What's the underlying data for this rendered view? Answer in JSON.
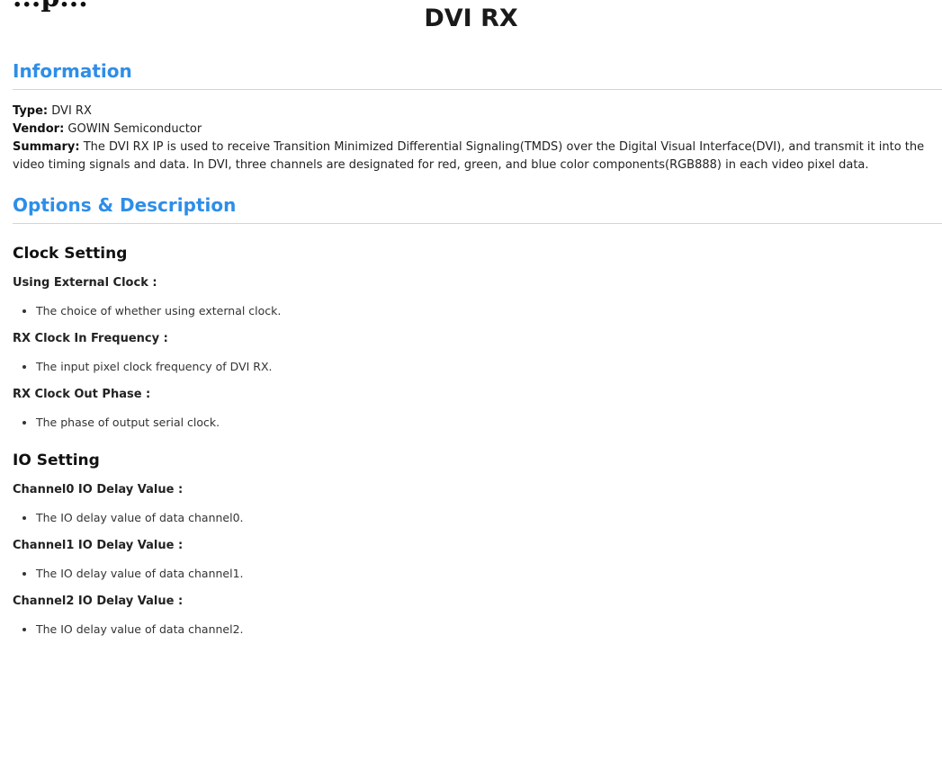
{
  "page": {
    "partial_heading": "...p...",
    "title": "DVI RX"
  },
  "information": {
    "heading": "Information",
    "type_label": "Type:",
    "type_value": "DVI RX",
    "vendor_label": "Vendor:",
    "vendor_value": "GOWIN Semiconductor",
    "summary_label": "Summary:",
    "summary_value": "The DVI RX IP is used to receive Transition Minimized Differential Signaling(TMDS) over the Digital Visual Interface(DVI), and transmit it into the video timing signals and data. In DVI, three channels are designated for red, green, and blue color components(RGB888) in each video pixel data."
  },
  "options": {
    "heading": "Options & Description",
    "groups": [
      {
        "title": "Clock Setting",
        "items": [
          {
            "label": "Using External Clock :",
            "desc": "The choice of whether using external clock."
          },
          {
            "label": "RX Clock In Frequency :",
            "desc": "The input pixel clock frequency of DVI RX."
          },
          {
            "label": "RX Clock Out Phase :",
            "desc": "The phase of output serial clock."
          }
        ]
      },
      {
        "title": "IO Setting",
        "items": [
          {
            "label": "Channel0 IO Delay Value :",
            "desc": "The IO delay value of data channel0."
          },
          {
            "label": "Channel1 IO Delay Value :",
            "desc": "The IO delay value of data channel1."
          },
          {
            "label": "Channel2 IO Delay Value :",
            "desc": "The IO delay value of data channel2."
          }
        ]
      }
    ]
  },
  "colors": {
    "section_heading": "#2e8ee8",
    "divider": "#d5d5d5"
  }
}
